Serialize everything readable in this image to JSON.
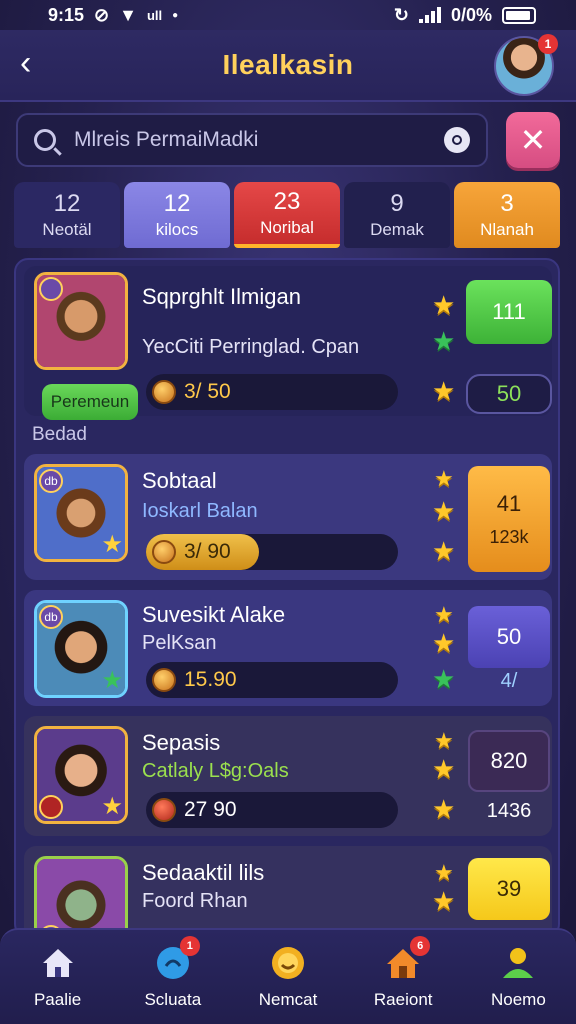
{
  "status_bar": {
    "time": "9:15",
    "battery": "0/0%"
  },
  "header": {
    "title": "Ilealkasin",
    "avatar_badge": "1"
  },
  "search": {
    "placeholder": "Mlreis PermaiMadki"
  },
  "tabs": [
    {
      "count": "12",
      "label": "Neotäl"
    },
    {
      "count": "12",
      "label": "kilocs"
    },
    {
      "count": "23",
      "label": "Noribal"
    },
    {
      "count": "9",
      "label": "Demak"
    },
    {
      "count": "3",
      "label": "Nlanah"
    }
  ],
  "tag_label": "Peremeun",
  "section_label": "Bedad",
  "games": [
    {
      "title": "Sqprghlt Ilmigan",
      "subtitle": "YecCiti Perringlad. Cpan",
      "subtitle_color": "#e4e2f6",
      "progress": "3/ 50",
      "progress_fraction": 0,
      "score_top": "111",
      "score_bottom": "50",
      "corner_label": "",
      "stars": [
        "gold",
        "green",
        "gold"
      ]
    },
    {
      "title": "Sobtaal",
      "subtitle": "Ioskarl Balan",
      "subtitle_color": "#8fb8ff",
      "progress": "3/ 90",
      "progress_fraction": 0.45,
      "score_top": "41",
      "score_bottom": "123k",
      "corner_label": "db",
      "stars": [
        "gold",
        "gold",
        "gold"
      ]
    },
    {
      "title": "Suvesikt Alake",
      "subtitle": "PelKsan",
      "subtitle_color": "#e4e2f6",
      "progress": "15.90",
      "progress_fraction": 0,
      "score_top": "50",
      "score_bottom": "4/",
      "corner_label": "db",
      "stars": [
        "gold",
        "gold",
        "green"
      ]
    },
    {
      "title": "Sepasis",
      "subtitle": "Catlaly L$g:Oals",
      "subtitle_color": "#9be04e",
      "progress": "27 90",
      "progress_fraction": 0,
      "score_top": "820",
      "score_bottom": "1436",
      "corner_label": "",
      "stars": [
        "gold",
        "gold",
        "gold"
      ]
    },
    {
      "title": "Sedaaktil lils",
      "subtitle": "Foord Rhan",
      "subtitle_color": "#e4e2f6",
      "progress": "",
      "progress_fraction": 0,
      "score_top": "39",
      "score_bottom": "",
      "corner_label": "db",
      "stars": [
        "gold",
        "gold"
      ]
    }
  ],
  "nav": [
    {
      "label": "Paalie",
      "icon": "home-icon",
      "badge": ""
    },
    {
      "label": "Scluata",
      "icon": "chat-icon",
      "badge": "1"
    },
    {
      "label": "Nemcat",
      "icon": "smiley-coin-icon",
      "badge": ""
    },
    {
      "label": "Raeiont",
      "icon": "house-icon",
      "badge": "6"
    },
    {
      "label": "Noemo",
      "icon": "profile-icon",
      "badge": ""
    }
  ],
  "colors": {
    "accent_gold": "#ffd15c",
    "tab_active": "#e54848",
    "green_button": "#4fcd44",
    "orange_button": "#f7a53a",
    "purple_button": "#5a52c2",
    "yellow_button": "#ffdf2a"
  }
}
